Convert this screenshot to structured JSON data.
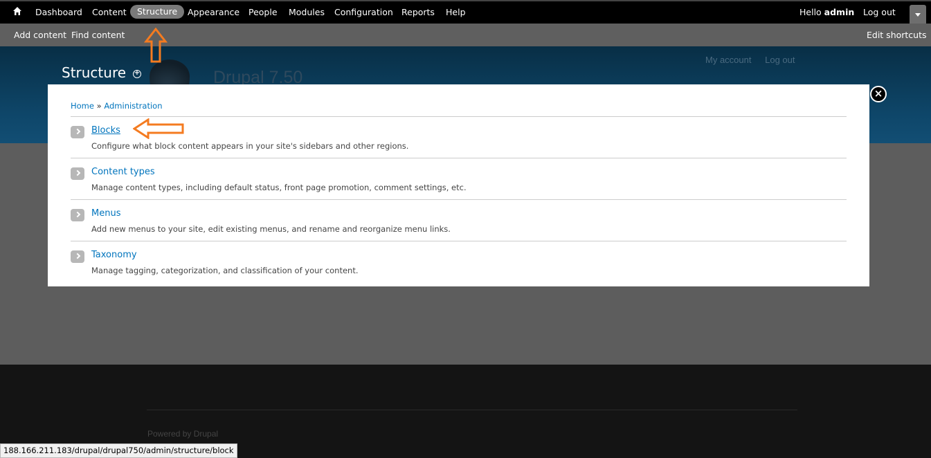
{
  "toolbar": {
    "home_icon": "home-icon",
    "items": [
      {
        "label": "Dashboard"
      },
      {
        "label": "Content"
      },
      {
        "label": "Structure",
        "active": true
      },
      {
        "label": "Appearance"
      },
      {
        "label": "People"
      },
      {
        "label": "Modules"
      },
      {
        "label": "Configuration"
      },
      {
        "label": "Reports"
      },
      {
        "label": "Help"
      }
    ],
    "hello_prefix": "Hello",
    "username": "admin",
    "logout": "Log out",
    "toggle_icon": "chevron-down-icon"
  },
  "shortcuts": {
    "items": [
      {
        "label": "Add content"
      },
      {
        "label": "Find content"
      }
    ],
    "edit": "Edit shortcuts"
  },
  "background_page": {
    "user_links": [
      "My account",
      "Log out"
    ],
    "site_name": "Drupal 7.50",
    "footer_powered_prefix": "Powered by",
    "footer_powered_link": "Drupal"
  },
  "overlay": {
    "title": "Structure",
    "add_icon": "plus-circle-icon",
    "close_icon": "close-icon",
    "breadcrumb": {
      "home": "Home",
      "separator": "»",
      "admin": "Administration"
    },
    "entries": [
      {
        "title": "Blocks",
        "description": "Configure what block content appears in your site's sidebars and other regions."
      },
      {
        "title": "Content types",
        "description": "Manage content types, including default status, front page promotion, comment settings, etc."
      },
      {
        "title": "Menus",
        "description": "Add new menus to your site, edit existing menus, and rename and reorganize menu links."
      },
      {
        "title": "Taxonomy",
        "description": "Manage tagging, categorization, and classification of your content."
      }
    ]
  },
  "annotations": {
    "color": "#f47b20"
  },
  "status_bar": {
    "url": "188.166.211.183/drupal/drupal750/admin/structure/block"
  }
}
